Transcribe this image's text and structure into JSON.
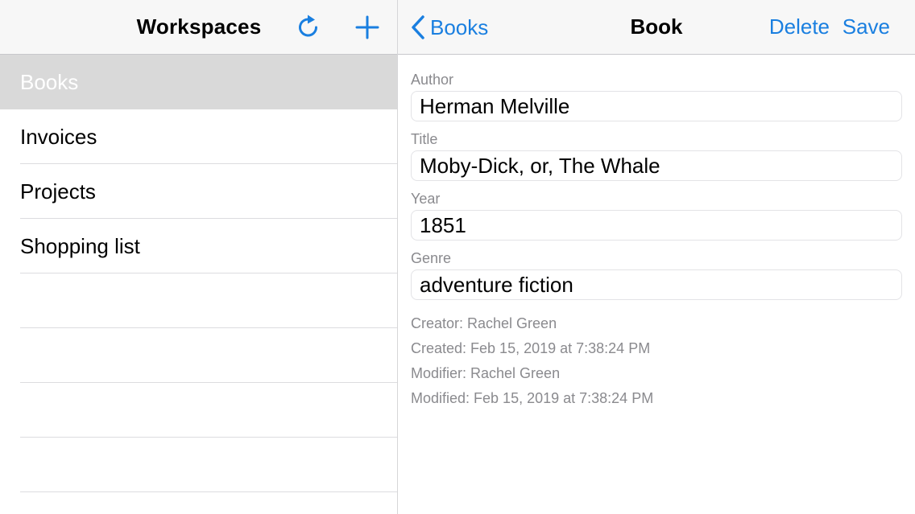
{
  "left": {
    "title": "Workspaces",
    "items": [
      {
        "label": "Books",
        "selected": true
      },
      {
        "label": "Invoices",
        "selected": false
      },
      {
        "label": "Projects",
        "selected": false
      },
      {
        "label": "Shopping list",
        "selected": false
      }
    ],
    "refresh_icon": "refresh-icon",
    "add_icon": "plus-icon"
  },
  "right": {
    "back_label": "Books",
    "title": "Book",
    "delete_label": "Delete",
    "save_label": "Save",
    "fields": [
      {
        "label": "Author",
        "value": "Herman Melville"
      },
      {
        "label": "Title",
        "value": "Moby-Dick, or, The Whale"
      },
      {
        "label": "Year",
        "value": "1851"
      },
      {
        "label": "Genre",
        "value": "adventure fiction"
      }
    ],
    "meta": {
      "creator": "Creator: Rachel Green",
      "created": "Created: Feb 15, 2019 at 7:38:24 PM",
      "modifier": "Modifier: Rachel Green",
      "modified": "Modified: Feb 15, 2019 at 7:38:24 PM"
    }
  },
  "colors": {
    "accent": "#1a7fe0",
    "selected_row": "#d9d9d9",
    "nav_bar": "#f7f7f7",
    "secondary_text": "#8a8a8e"
  }
}
